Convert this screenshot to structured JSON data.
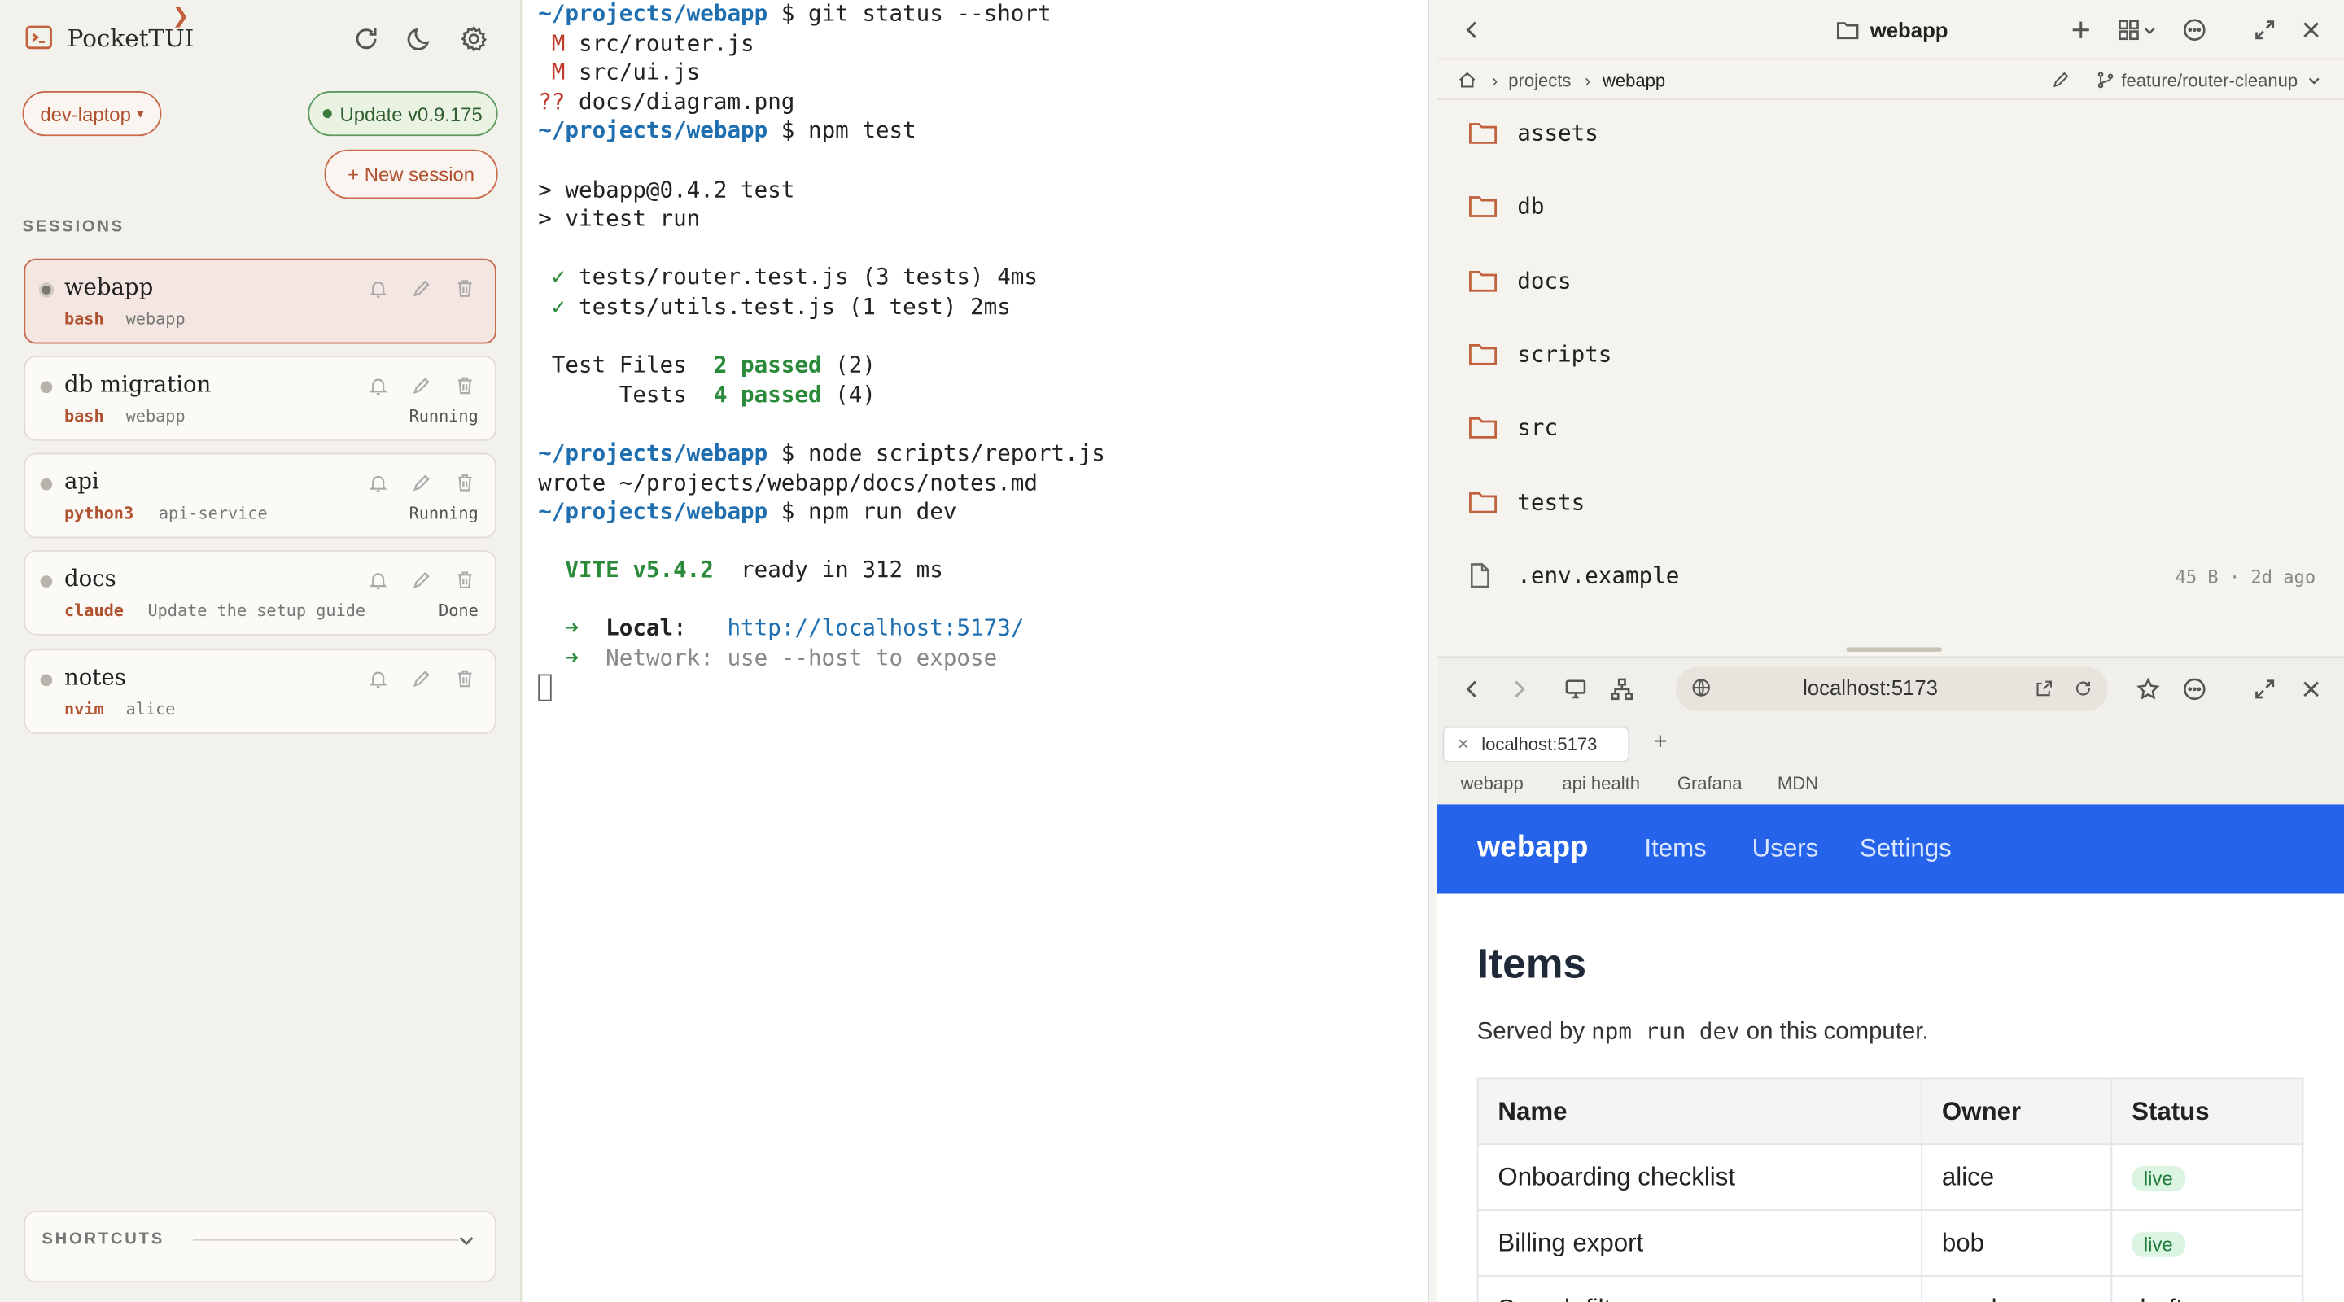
{
  "sidebar": {
    "app_name": "PocketTUI",
    "host_label": "dev-laptop",
    "host_arrow": "▾",
    "update_label": "Update v0.9.175",
    "new_session_label": "+ New session",
    "sessions_heading": "SESSIONS",
    "sessions": [
      {
        "name": "webapp",
        "shell": "bash",
        "dir": "webapp",
        "state": "",
        "active": true
      },
      {
        "name": "db migration",
        "shell": "bash",
        "dir": "webapp",
        "state": "Running",
        "active": false
      },
      {
        "name": "api",
        "shell": "python3",
        "dir": "api-service",
        "state": "Running",
        "active": false
      },
      {
        "name": "docs",
        "shell": "claude",
        "dir": "Update the setup guide",
        "state": "Done",
        "active": false
      },
      {
        "name": "notes",
        "shell": "nvim",
        "dir": "alice",
        "state": "",
        "active": false
      }
    ],
    "shortcuts_heading": "SHORTCUTS"
  },
  "terminal": {
    "t1_path": "~/projects/webapp",
    "t1_cmd": " $ git status --short",
    "t2_mod": " M",
    "t2_file": " src/router.js",
    "t3_mod": " M",
    "t3_file": " src/ui.js",
    "t4_mod": "??",
    "t4_file": " docs/diagram.png",
    "t5_path": "~/projects/webapp",
    "t5_cmd": " $ npm test",
    "t7": "> webapp@0.4.2 test",
    "t8": "> vitest run",
    "t10_check": " ✓",
    "t10_text": " tests/router.test.js (3 tests) 4ms",
    "t11_check": " ✓",
    "t11_text": " tests/utils.test.js (1 test) 2ms",
    "t13_label": " Test Files  ",
    "t13_pass": "2 passed",
    "t13_count": " (2)",
    "t14_label": "      Tests  ",
    "t14_pass": "4 passed",
    "t14_count": " (4)",
    "t16_path": "~/projects/webapp",
    "t16_cmd": " $ node scripts/report.js",
    "t17": "wrote ~/projects/webapp/docs/notes.md",
    "t18_path": "~/projects/webapp",
    "t18_cmd": " $ npm run dev",
    "t20_vite": "  VITE v5.4.2",
    "t20_ready": "  ready in 312 ms",
    "t22_arrow": "  ➜  ",
    "t22_label": "Local",
    "t22_colon": ":   ",
    "t22_url": "http://localhost:5173/",
    "t23_arrow": "  ➜  ",
    "t23_text": "Network: use --host to expose"
  },
  "files": {
    "title": "webapp",
    "breadcrumb": [
      "projects",
      "webapp"
    ],
    "branch": "feature/router-cleanup",
    "entries": [
      {
        "name": "assets",
        "type": "folder",
        "meta": ""
      },
      {
        "name": "db",
        "type": "folder",
        "meta": ""
      },
      {
        "name": "docs",
        "type": "folder",
        "meta": ""
      },
      {
        "name": "scripts",
        "type": "folder",
        "meta": ""
      },
      {
        "name": "src",
        "type": "folder",
        "meta": ""
      },
      {
        "name": "tests",
        "type": "folder",
        "meta": ""
      },
      {
        "name": ".env.example",
        "type": "file",
        "meta": "45 B · 2d ago"
      }
    ]
  },
  "browser": {
    "url": "localhost:5173",
    "tab_title": "localhost:5173",
    "bookmarks": [
      "webapp",
      "api health",
      "Grafana",
      "MDN"
    ],
    "page": {
      "brand": "webapp",
      "nav_links": [
        "Items",
        "Users",
        "Settings"
      ],
      "heading": "Items",
      "subtitle_pre": "Served by ",
      "subtitle_code": "npm run dev",
      "subtitle_post": " on this computer.",
      "columns": [
        "Name",
        "Owner",
        "Status"
      ],
      "rows": [
        {
          "name": "Onboarding checklist",
          "owner": "alice",
          "status": "live"
        },
        {
          "name": "Billing export",
          "owner": "bob",
          "status": "live"
        },
        {
          "name": "Search filters",
          "owner": "carol",
          "status": "draft"
        }
      ]
    }
  },
  "colors": {
    "accent": "#c0603c",
    "nav_blue": "#2563eb",
    "terminal_blue": "#1f6fb0",
    "terminal_green": "#2a8a3a"
  }
}
